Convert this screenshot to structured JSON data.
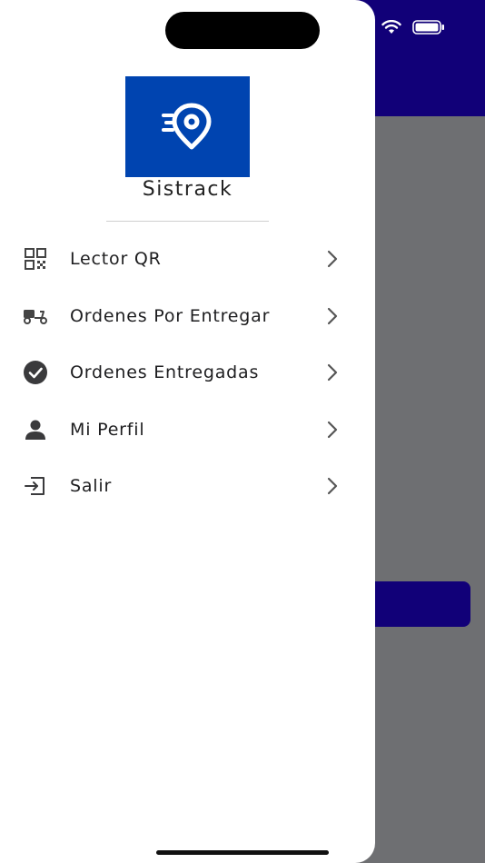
{
  "app": {
    "brand_name": "Sistrack",
    "logo_icon": "location-pin-speed-icon",
    "brand_color": "#0044b0",
    "header_color": "#110078"
  },
  "drawer": {
    "items": [
      {
        "label": "Lector QR",
        "icon": "qr-code-icon"
      },
      {
        "label": "Ordenes Por Entregar",
        "icon": "delivery-scooter-icon"
      },
      {
        "label": "Ordenes Entregadas",
        "icon": "check-circle-icon"
      },
      {
        "label": "Mi Perfil",
        "icon": "person-icon"
      },
      {
        "label": "Salir",
        "icon": "logout-icon"
      }
    ]
  }
}
